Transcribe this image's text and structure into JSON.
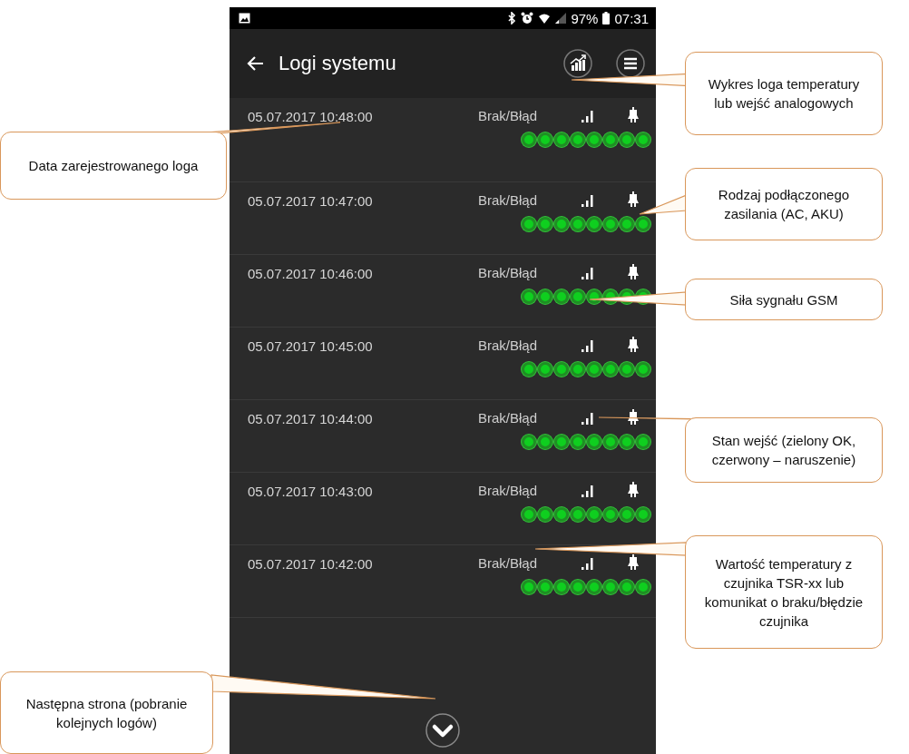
{
  "status_bar": {
    "battery": "97%",
    "time": "07:31"
  },
  "app_bar": {
    "title": "Logi systemu"
  },
  "logs": [
    {
      "date": "05.07.2017 10:48:00",
      "temperature": "Brak/Błąd",
      "inputs": [
        {
          "violation": false
        },
        {
          "violation": false
        },
        {
          "violation": false
        },
        {
          "violation": false
        },
        {
          "violation": false
        },
        {
          "violation": false
        },
        {
          "violation": false
        },
        {
          "violation": false
        }
      ]
    },
    {
      "date": "05.07.2017 10:47:00",
      "temperature": "Brak/Błąd",
      "inputs": [
        {
          "violation": false
        },
        {
          "violation": false
        },
        {
          "violation": false
        },
        {
          "violation": false
        },
        {
          "violation": false
        },
        {
          "violation": false
        },
        {
          "violation": false
        },
        {
          "violation": false
        }
      ]
    },
    {
      "date": "05.07.2017 10:46:00",
      "temperature": "Brak/Błąd",
      "inputs": [
        {
          "violation": false
        },
        {
          "violation": false
        },
        {
          "violation": false
        },
        {
          "violation": false
        },
        {
          "violation": false
        },
        {
          "violation": false
        },
        {
          "violation": false
        },
        {
          "violation": false
        }
      ]
    },
    {
      "date": "05.07.2017 10:45:00",
      "temperature": "Brak/Błąd",
      "inputs": [
        {
          "violation": false
        },
        {
          "violation": false
        },
        {
          "violation": false
        },
        {
          "violation": false
        },
        {
          "violation": false
        },
        {
          "violation": false
        },
        {
          "violation": false
        },
        {
          "violation": false
        }
      ]
    },
    {
      "date": "05.07.2017 10:44:00",
      "temperature": "Brak/Błąd",
      "inputs": [
        {
          "violation": false
        },
        {
          "violation": false
        },
        {
          "violation": false
        },
        {
          "violation": false
        },
        {
          "violation": false
        },
        {
          "violation": false
        },
        {
          "violation": false
        },
        {
          "violation": false
        }
      ]
    },
    {
      "date": "05.07.2017 10:43:00",
      "temperature": "Brak/Błąd",
      "inputs": [
        {
          "violation": false
        },
        {
          "violation": false
        },
        {
          "violation": false
        },
        {
          "violation": false
        },
        {
          "violation": false
        },
        {
          "violation": false
        },
        {
          "violation": false
        },
        {
          "violation": false
        }
      ]
    },
    {
      "date": "05.07.2017 10:42:00",
      "temperature": "Brak/Błąd",
      "inputs": [
        {
          "violation": false
        },
        {
          "violation": false
        },
        {
          "violation": false
        },
        {
          "violation": false
        },
        {
          "violation": false
        },
        {
          "violation": false
        },
        {
          "violation": false
        },
        {
          "violation": false
        }
      ]
    }
  ],
  "callouts": [
    {
      "text": "Wykres loga temperatury lub wejść analogowych"
    },
    {
      "text": "Data zarejestrowanego loga"
    },
    {
      "text": "Rodzaj podłączonego zasilania (AC, AKU)"
    },
    {
      "text": "Siła sygnału GSM"
    },
    {
      "text": "Stan wejść (zielony OK, czerwony – naruszenie)"
    },
    {
      "text": "Wartość temperatury z czujnika TSR-xx lub komunikat o braku/błędzie czujnika"
    },
    {
      "text": "Następna strona (pobranie kolejnych logów)"
    }
  ]
}
